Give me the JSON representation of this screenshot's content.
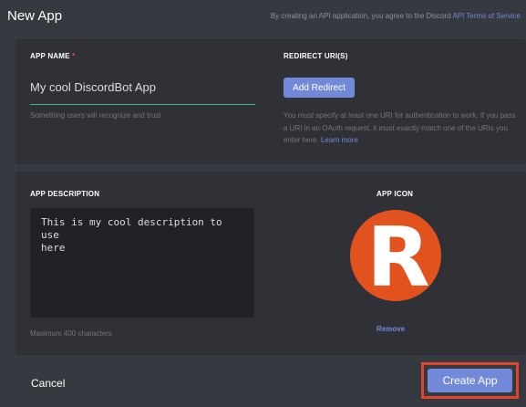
{
  "header": {
    "title": "New App",
    "terms_prefix": "By creating an API application, you agree to the Discord ",
    "terms_link": "API Terms of Service"
  },
  "app_name": {
    "label": "APP NAME",
    "required_mark": "*",
    "value": "My cool DiscordBot App",
    "hint": "Something users will recognize and trust"
  },
  "redirect": {
    "label": "REDIRECT URI(S)",
    "button": "Add Redirect",
    "hint": "You must specify at least one URI for authentication to work. If you pass a URI in an OAuth request, it must exactly match one of the URIs you enter here.",
    "learn_more": "Learn more"
  },
  "description": {
    "label": "APP DESCRIPTION",
    "value": "This is my cool description to use\nhere",
    "hint": "Maximum 400 characters"
  },
  "app_icon": {
    "label": "APP ICON",
    "letter": "R",
    "circle_color": "#e2521f",
    "remove": "Remove"
  },
  "footer": {
    "cancel": "Cancel",
    "create": "Create App",
    "highlight_color": "#e0442c"
  }
}
